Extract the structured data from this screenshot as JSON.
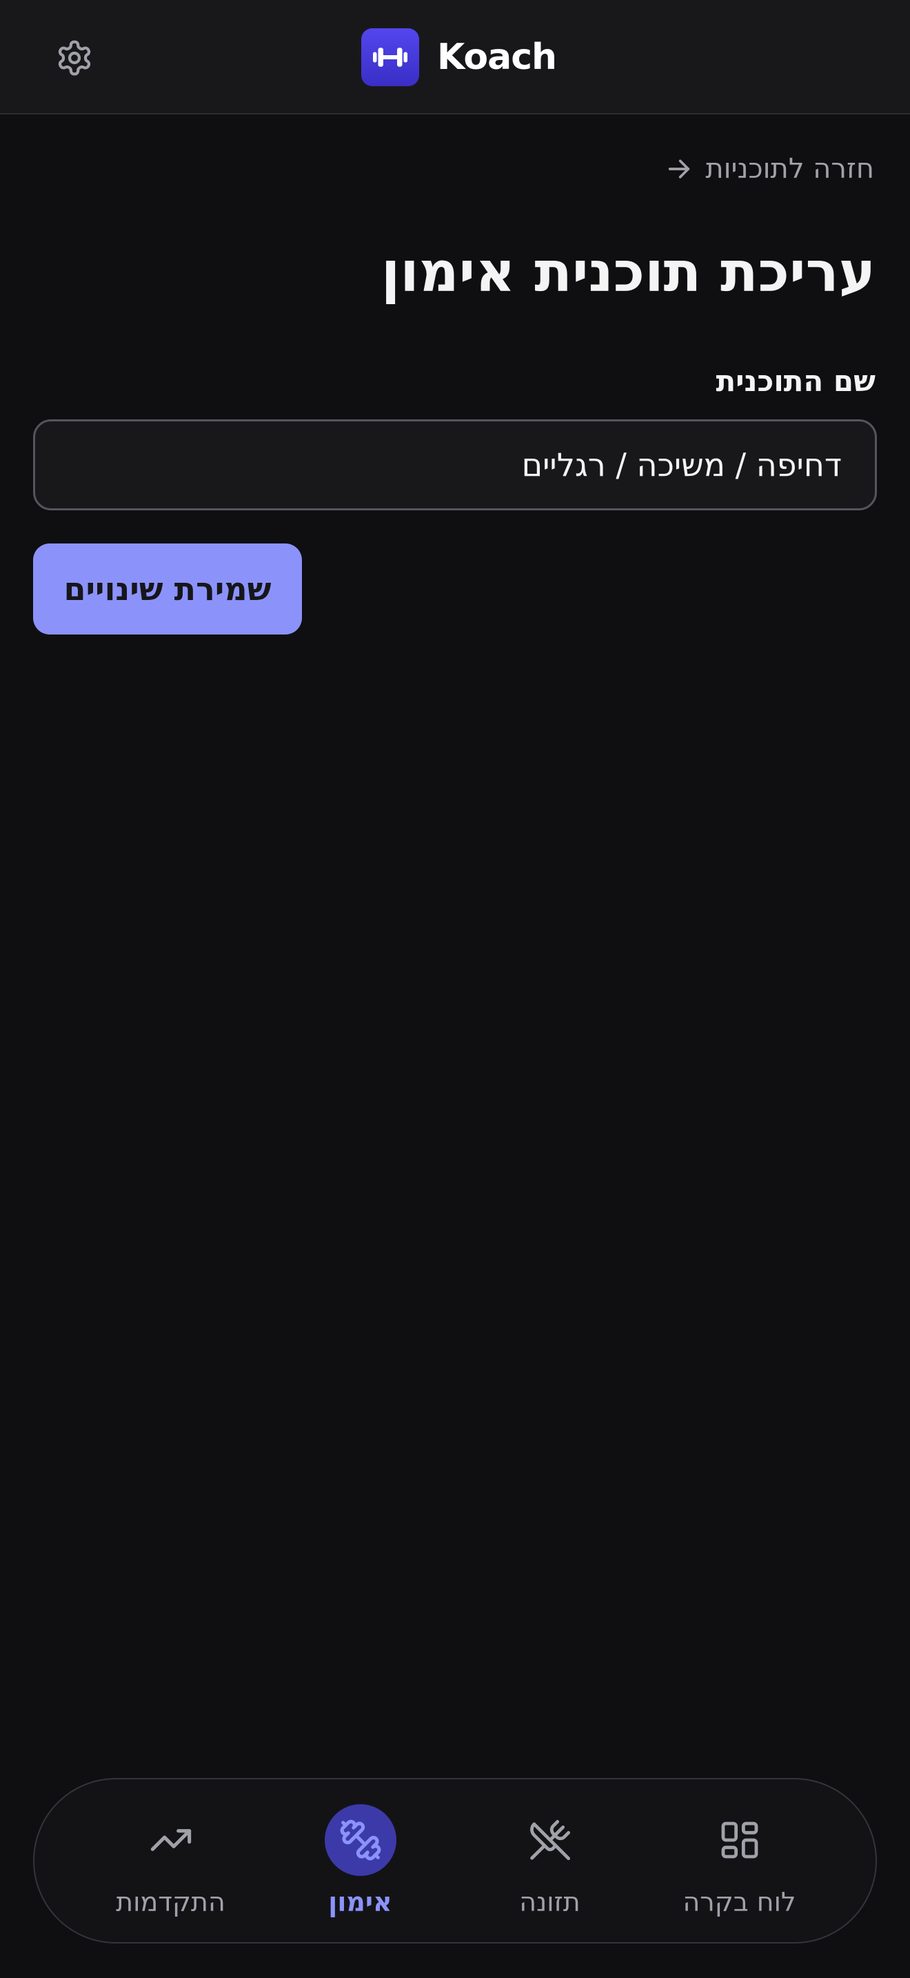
{
  "header": {
    "brand_name": "Koach",
    "settings_icon": "gear-icon",
    "logo_icon": "dumbbell-icon"
  },
  "back_link": {
    "label": "חזרה לתוכניות",
    "icon": "arrow-right-icon"
  },
  "page_title": "עריכת תוכנית אימון",
  "form": {
    "name_label": "שם התוכנית",
    "name_value": "דחיפה / משיכה / רגליים",
    "save_label": "שמירת שינויים"
  },
  "nav": {
    "items": [
      {
        "label": "לוח בקרה",
        "icon": "dashboard-icon",
        "active": false
      },
      {
        "label": "תזונה",
        "icon": "utensils-crossed-icon",
        "active": false
      },
      {
        "label": "אימון",
        "icon": "dumbbell-icon",
        "active": true
      },
      {
        "label": "התקדמות",
        "icon": "trending-up-icon",
        "active": false
      }
    ]
  },
  "colors": {
    "background": "#0f0f11",
    "header": "#18181b",
    "accent": "#8b93fb",
    "logo": "#4a3ee0",
    "active_nav_bg": "#3c3aa8",
    "muted_text": "#a1a1aa"
  }
}
